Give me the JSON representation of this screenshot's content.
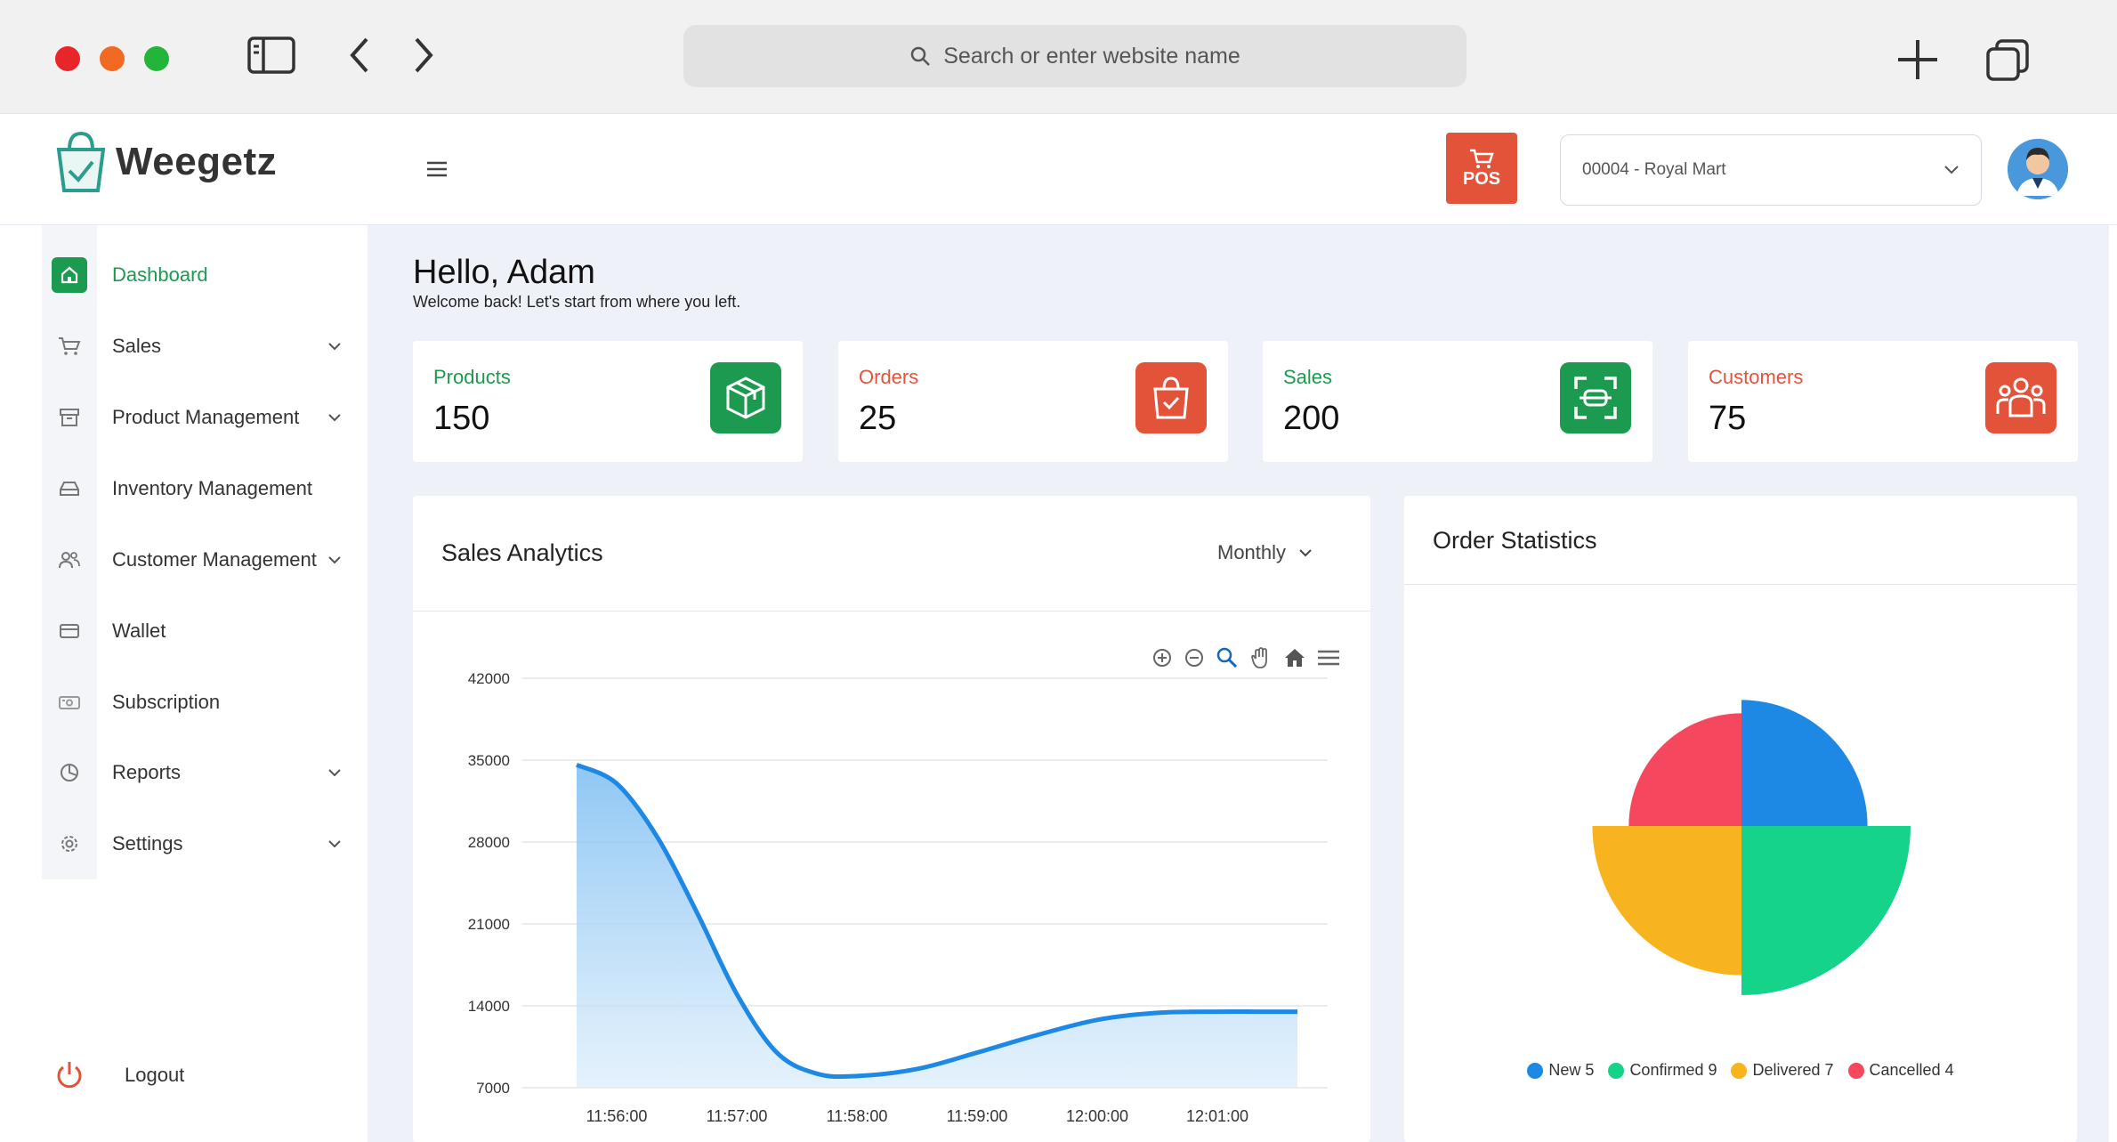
{
  "browser": {
    "search_placeholder": "Search or enter website name"
  },
  "brand": {
    "name": "Weegetz",
    "accent": "#1c9a4f"
  },
  "header": {
    "pos_label": "POS",
    "store": "00004 - Royal Mart"
  },
  "sidebar": {
    "items": [
      {
        "label": "Dashboard"
      },
      {
        "label": "Sales"
      },
      {
        "label": "Product Management"
      },
      {
        "label": "Inventory Management"
      },
      {
        "label": "Customer Management"
      },
      {
        "label": "Wallet"
      },
      {
        "label": "Subscription"
      },
      {
        "label": "Reports"
      },
      {
        "label": "Settings"
      }
    ],
    "logout": "Logout"
  },
  "greeting": {
    "title": "Hello, Adam",
    "subtitle": "Welcome back! Let's start from where you left."
  },
  "stats": [
    {
      "label": "Products",
      "value": "150",
      "color": "#1c9a4f"
    },
    {
      "label": "Orders",
      "value": "25",
      "color": "#e2533a"
    },
    {
      "label": "Sales",
      "value": "200",
      "color": "#1c9a4f"
    },
    {
      "label": "Customers",
      "value": "75",
      "color": "#e2533a"
    }
  ],
  "sales_panel": {
    "title": "Sales Analytics",
    "period": "Monthly"
  },
  "order_panel": {
    "title": "Order Statistics"
  },
  "chart_data": [
    {
      "type": "area",
      "title": "",
      "x": [
        "11:55:40",
        "11:56:00",
        "11:56:20",
        "11:56:40",
        "11:57:00",
        "11:57:20",
        "11:57:40",
        "11:58:00",
        "11:58:30",
        "11:59:00",
        "11:59:30",
        "12:00:00",
        "12:00:30",
        "12:01:00",
        "12:01:20",
        "12:01:40"
      ],
      "series": [
        {
          "values": [
            34600,
            33000,
            28500,
            22000,
            15000,
            10000,
            8200,
            8000,
            8600,
            10000,
            11500,
            12800,
            13400,
            13500,
            13500,
            13500
          ]
        }
      ],
      "x_ticks": [
        "11:56:00",
        "11:57:00",
        "11:58:00",
        "11:59:00",
        "12:00:00",
        "12:01:00"
      ],
      "y_ticks": [
        "7000",
        "14000",
        "21000",
        "28000",
        "35000",
        "42000"
      ],
      "ylim": [
        7000,
        42000
      ],
      "color": "#1e88e5",
      "grid": true
    },
    {
      "type": "polarArea",
      "categories": [
        "New",
        "Confirmed",
        "Delivered",
        "Cancelled"
      ],
      "values": [
        5,
        9,
        7,
        4
      ],
      "colors": [
        "#1e88e5",
        "#16d38a",
        "#f8b41f",
        "#f5485e"
      ],
      "legend": [
        "New 5",
        "Confirmed 9",
        "Delivered 7",
        "Cancelled 4"
      ],
      "legend_position": "bottom"
    }
  ]
}
